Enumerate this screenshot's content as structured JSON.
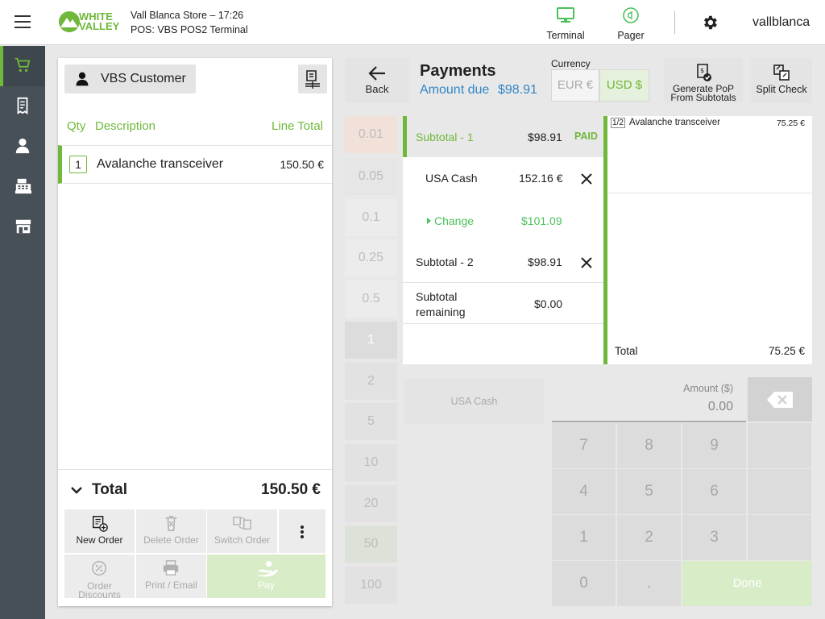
{
  "header": {
    "logo_line1": "WHITE",
    "logo_line2": "VALLEY",
    "store_line": "Vall Blanca Store – 17:26",
    "pos_line": "POS: VBS POS2 Terminal",
    "terminal_label": "Terminal",
    "pager_label": "Pager",
    "username": "vallblanca"
  },
  "colors": {
    "accent": "#6fb83a",
    "blue": "#2f86c6",
    "sidebar": "#474f57"
  },
  "sidebar": {
    "items": [
      {
        "icon": "cart-icon",
        "active": true
      },
      {
        "icon": "receipt-icon"
      },
      {
        "icon": "person-icon"
      },
      {
        "icon": "cash-register-icon"
      },
      {
        "icon": "store-icon"
      }
    ]
  },
  "order": {
    "customer": "VBS Customer",
    "col_qty": "Qty",
    "col_desc": "Description",
    "col_total": "Line Total",
    "lines": [
      {
        "qty": "1",
        "desc": "Avalanche transceiver",
        "total": "150.50 €"
      }
    ],
    "total_label": "Total",
    "total_value": "150.50 €",
    "actions": {
      "new_order": "New Order",
      "delete_order": "Delete Order",
      "switch_order": "Switch Order",
      "order_discounts_1": "Order",
      "order_discounts_2": "Discounts",
      "print_email": "Print / Email",
      "pay": "Pay"
    }
  },
  "payments": {
    "back": "Back",
    "title": "Payments",
    "amount_due_label": "Amount due",
    "amount_due_value": "$98.91",
    "currency_label": "Currency",
    "eur": "EUR €",
    "usd": "USD $",
    "pop_1": "Generate PoP",
    "pop_2": "From Subtotals",
    "split": "Split Check",
    "denominations": [
      "0.01",
      "0.05",
      "0.1",
      "0.25",
      "0.5",
      "1",
      "2",
      "5",
      "10",
      "20",
      "50",
      "100"
    ],
    "subtotal1": {
      "label": "Subtotal - 1",
      "value": "$98.91",
      "status": "PAID"
    },
    "cash": {
      "label": "USA Cash",
      "value": "152.16 €"
    },
    "change": {
      "label": "Change",
      "value": "$101.09"
    },
    "subtotal2": {
      "label": "Subtotal - 2",
      "value": "$98.91"
    },
    "remaining": {
      "label_1": "Subtotal",
      "label_2": "remaining",
      "value": "$0.00"
    },
    "split_item": {
      "qty": "1/2",
      "desc": "Avalanche transceiver",
      "value": "75.25 €"
    },
    "split_total": {
      "label": "Total",
      "value": "75.25 €"
    },
    "usa_cash_button": "USA Cash",
    "amount_label": "Amount ($)",
    "amount_value": "0.00",
    "keys": [
      "7",
      "8",
      "9",
      "4",
      "5",
      "6",
      "1",
      "2",
      "3",
      "0",
      "."
    ],
    "done": "Done"
  }
}
